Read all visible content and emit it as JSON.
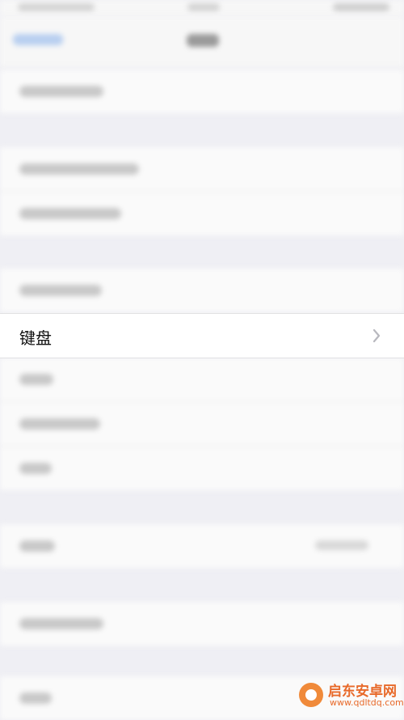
{
  "settings": {
    "keyboard_label": "键盘"
  },
  "watermark": {
    "brand": "启东安卓网",
    "url": "www.qdltdq.com"
  },
  "icons": {
    "disclosure": "chevron-right-icon"
  }
}
